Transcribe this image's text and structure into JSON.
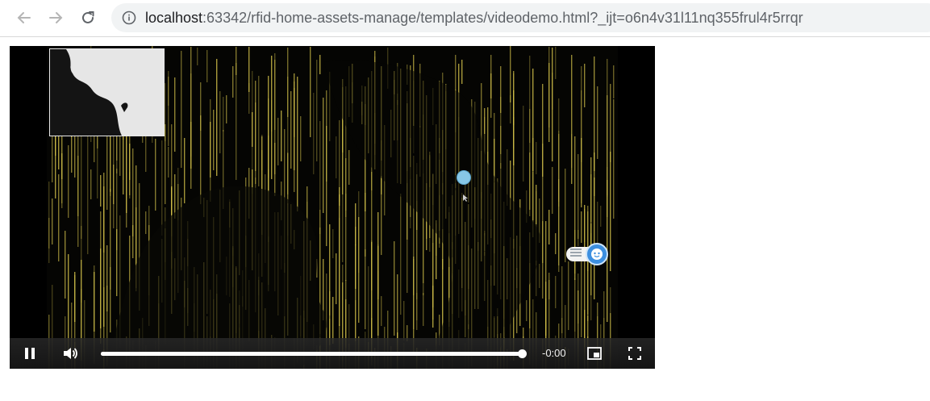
{
  "browser": {
    "url_host": "localhost",
    "url_rest": ":63342/rfid-home-assets-manage/templates/videodemo.html?_ijt=o6n4v31l11nq355frul4r5rrqr",
    "icons": {
      "back": "arrow-left-icon",
      "forward": "arrow-right-icon",
      "reload": "reload-icon",
      "site_info": "info-circle-icon"
    }
  },
  "video": {
    "playing": true,
    "time_display": "-0:00",
    "progress": 1.0,
    "colors": {
      "controls_bg": "#1c1c1c",
      "accent": "#ffffff",
      "rain": "#d4c24a"
    },
    "icons": {
      "play_pause": "pause-icon",
      "volume": "volume-icon",
      "pip": "picture-in-picture-icon",
      "fullscreen": "fullscreen-icon"
    }
  },
  "overlays": {
    "thumbnail_icon": "silhouette-thumbnail",
    "dot_color": "#87c7e6",
    "assistant_icon": "chat-assistant-icon"
  }
}
